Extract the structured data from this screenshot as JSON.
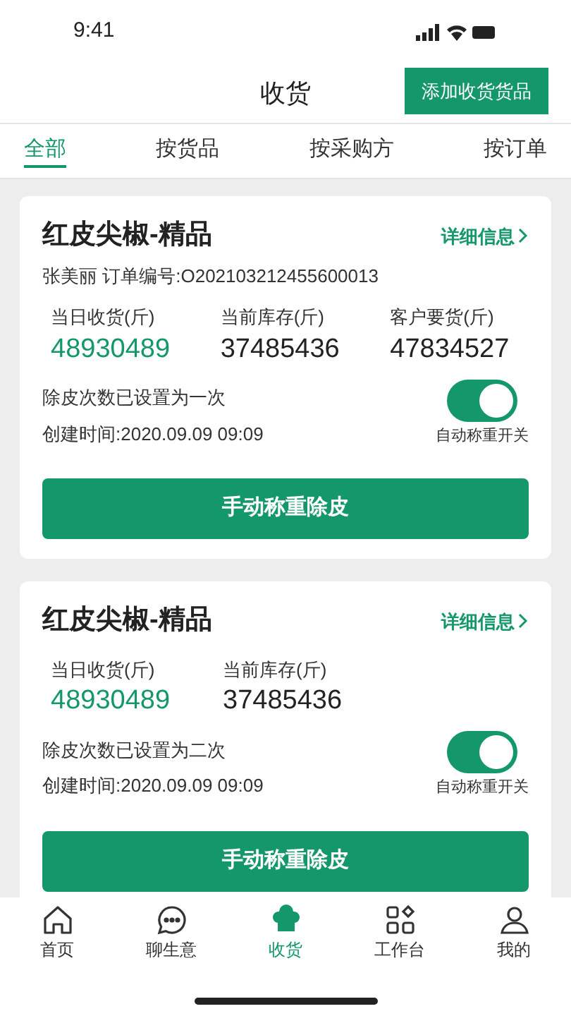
{
  "status_bar": {
    "time": "9:41"
  },
  "header": {
    "title": "收货",
    "action": "添加收货货品"
  },
  "tabs": [
    {
      "label": "全部",
      "selected": true
    },
    {
      "label": "按货品",
      "selected": false
    },
    {
      "label": "按采购方",
      "selected": false
    },
    {
      "label": "按订单",
      "selected": false
    }
  ],
  "cards": [
    {
      "title": "红皮尖椒-精品",
      "detail_link": "详细信息",
      "meta": "张美丽 订单编号:O202103212455600013",
      "stats": [
        {
          "label": "当日收货(斤)",
          "value": "48930489",
          "highlight": true
        },
        {
          "label": "当前库存(斤)",
          "value": "37485436",
          "highlight": false
        },
        {
          "label": "客户要货(斤)",
          "value": "47834527",
          "highlight": false
        }
      ],
      "tare_note": "除皮次数已设置为一次",
      "created": "创建时间:2020.09.09 09:09",
      "switch_label": "自动称重开关",
      "auto_weigh": true,
      "button": "手动称重除皮"
    },
    {
      "title": "红皮尖椒-精品",
      "detail_link": "详细信息",
      "stats": [
        {
          "label": "当日收货(斤)",
          "value": "48930489",
          "highlight": true
        },
        {
          "label": "当前库存(斤)",
          "value": "37485436",
          "highlight": false
        }
      ],
      "tare_note": "除皮次数已设置为二次",
      "created": "创建时间:2020.09.09 09:09",
      "switch_label": "自动称重开关",
      "auto_weigh": true,
      "button": "手动称重除皮"
    }
  ],
  "bottom_nav": [
    {
      "label": "首页",
      "selected": false
    },
    {
      "label": "聊生意",
      "selected": false
    },
    {
      "label": "收货",
      "selected": true
    },
    {
      "label": "工作台",
      "selected": false
    },
    {
      "label": "我的",
      "selected": false
    }
  ]
}
